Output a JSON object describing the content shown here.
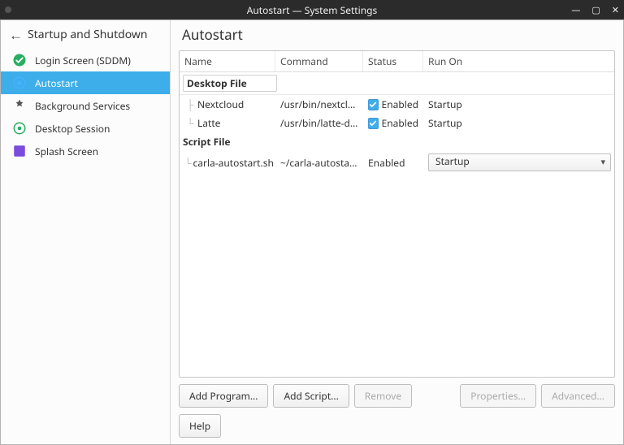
{
  "titlebar": {
    "title": "Autostart — System Settings"
  },
  "sidebar": {
    "header": "Startup and Shutdown",
    "items": [
      {
        "label": "Login Screen (SDDM)"
      },
      {
        "label": "Autostart"
      },
      {
        "label": "Background Services"
      },
      {
        "label": "Desktop Session"
      },
      {
        "label": "Splash Screen"
      }
    ]
  },
  "page": {
    "title": "Autostart"
  },
  "columns": {
    "name": "Name",
    "command": "Command",
    "status": "Status",
    "run_on": "Run On"
  },
  "sections": {
    "desktop": {
      "title": "Desktop File",
      "rows": [
        {
          "name": "Nextcloud",
          "command": "/usr/bin/nextcloud",
          "status": "Enabled",
          "checked": true,
          "run_on": "Startup"
        },
        {
          "name": "Latte",
          "command": "/usr/bin/latte-dock",
          "status": "Enabled",
          "checked": true,
          "run_on": "Startup"
        }
      ]
    },
    "script": {
      "title": "Script File",
      "rows": [
        {
          "name": "carla-autostart.sh",
          "command": "~/carla-autostart.sh",
          "status": "Enabled",
          "checked": false,
          "run_on": "Startup"
        }
      ]
    }
  },
  "buttons": {
    "add_program": "Add Program...",
    "add_script": "Add Script...",
    "remove": "Remove",
    "properties": "Properties...",
    "advanced": "Advanced...",
    "help": "Help"
  }
}
